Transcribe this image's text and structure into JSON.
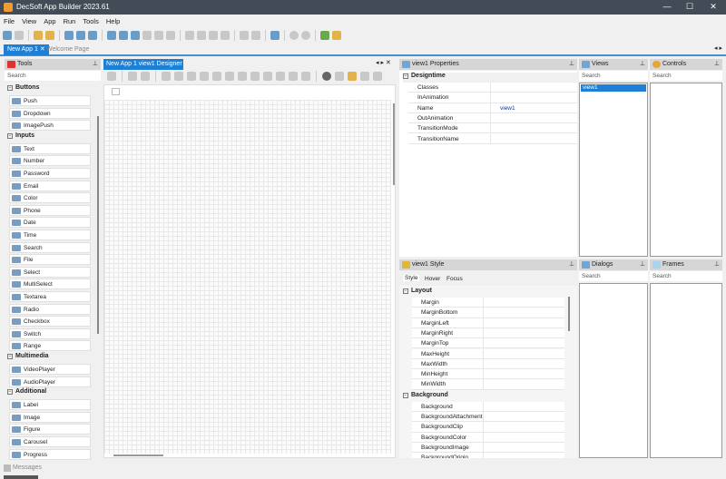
{
  "window": {
    "title": "DecSoft App Builder 2023.61",
    "minimize": "—",
    "maximize": "☐",
    "close": "✕"
  },
  "menu": [
    "File",
    "View",
    "App",
    "Run",
    "Tools",
    "Help"
  ],
  "doc_tabs": [
    {
      "label": "New App 1",
      "close": "✕"
    },
    {
      "label": "Welcome Page"
    }
  ],
  "tools": {
    "title": "Tools",
    "pin": "📌",
    "search": "Search",
    "groups": [
      {
        "label": "Buttons",
        "items": [
          "Push",
          "Dropdown",
          "ImagePush"
        ]
      },
      {
        "label": "Inputs",
        "items": [
          "Text",
          "Number",
          "Password",
          "Email",
          "Color",
          "Phone",
          "Date",
          "Time",
          "Search",
          "File",
          "Select",
          "MultiSelect",
          "Textarea",
          "Radio",
          "Checkbox",
          "Switch",
          "Range"
        ]
      },
      {
        "label": "Multimedia",
        "items": [
          "VideoPlayer",
          "AudioPlayer"
        ]
      },
      {
        "label": "Additional",
        "items": [
          "Label",
          "Image",
          "Figure",
          "Carousel",
          "Progress"
        ]
      }
    ]
  },
  "designer": {
    "tab": "New App 1 view1 Designer",
    "close": "✕"
  },
  "properties": {
    "title": "view1 Properties",
    "group": "Designtime",
    "rows": [
      {
        "k": "Classes",
        "v": ""
      },
      {
        "k": "InAnimation",
        "v": ""
      },
      {
        "k": "Name",
        "v": "view1"
      },
      {
        "k": "OutAnimation",
        "v": ""
      },
      {
        "k": "TransitionMode",
        "v": ""
      },
      {
        "k": "TransitionName",
        "v": ""
      }
    ]
  },
  "views": {
    "title": "Views",
    "search": "Search",
    "items": [
      "view1"
    ]
  },
  "controls": {
    "title": "Controls",
    "search": "Search"
  },
  "dialogs": {
    "title": "Dialogs",
    "search": "Search"
  },
  "frames": {
    "title": "Frames",
    "search": "Search"
  },
  "style": {
    "title": "view1 Style",
    "tabs": [
      "Style",
      "Hover",
      "Focus"
    ],
    "layout_group": "Layout",
    "layout_rows": [
      "Margin",
      "MarginBottom",
      "MarginLeft",
      "MarginRight",
      "MarginTop",
      "MaxHeight",
      "MaxWidth",
      "MinHeight",
      "MinWidth"
    ],
    "background_group": "Background",
    "background_rows": [
      "Background",
      "BackgroundAttachment",
      "BackgroundClip",
      "BackgroundColor",
      "BackgroundImage",
      "BackgroundOrigin"
    ]
  },
  "messages": "Messages"
}
